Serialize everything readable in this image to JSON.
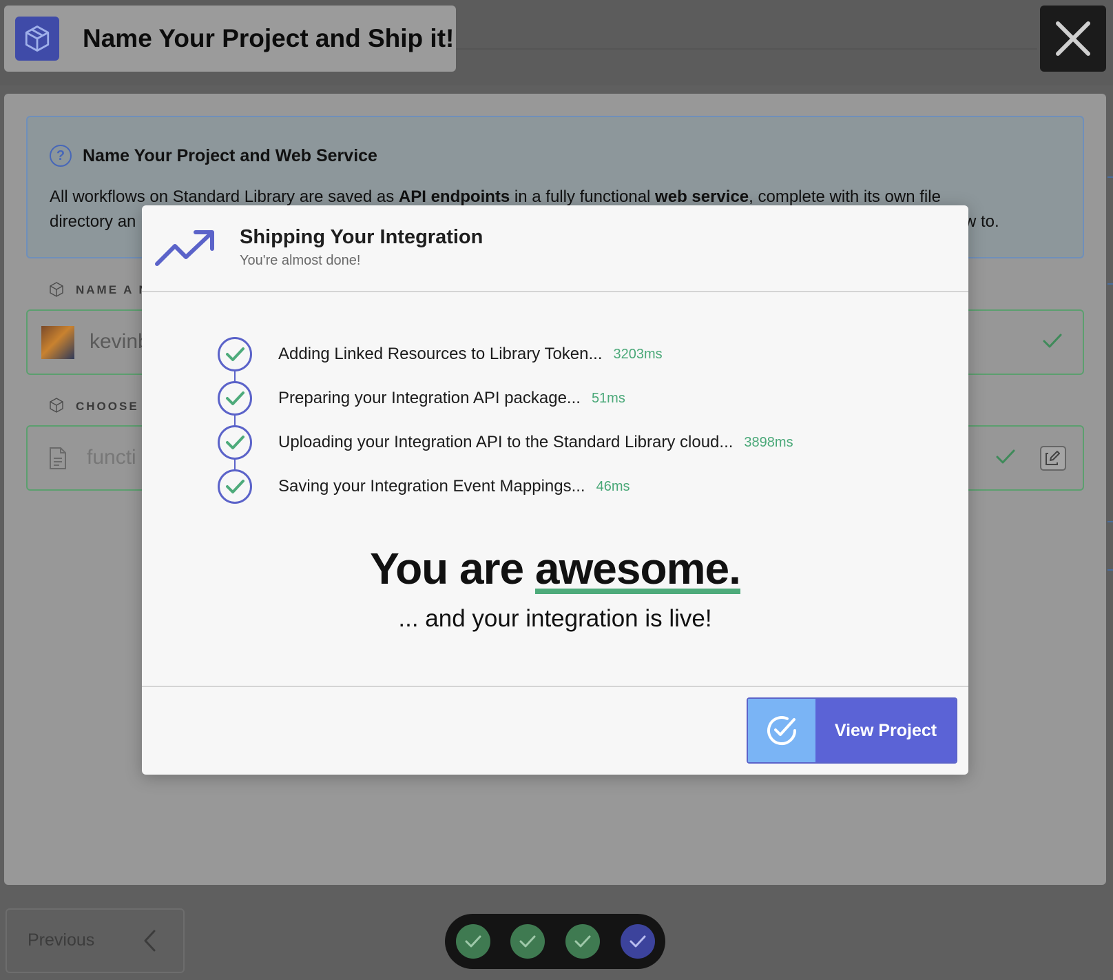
{
  "header": {
    "title": "Name Your Project and Ship it!",
    "icon": "package-icon",
    "close_icon": "close-icon"
  },
  "info": {
    "title": "Name Your Project and Web Service",
    "line1_prefix": "All workflows on Standard Library are saved as ",
    "line1_bold1": "API endpoints",
    "line1_mid": " in a fully functional ",
    "line1_bold2": "web service",
    "line1_suffix": ", complete with its own file",
    "line2_start": "directory an",
    "line2_end": "w to."
  },
  "fields": {
    "name_label": "NAME A N",
    "name_value": "kevinb",
    "choose_label": "CHOOSE T",
    "choose_value": "functi"
  },
  "modal": {
    "title": "Shipping Your Integration",
    "subtitle": "You're almost done!",
    "steps": [
      {
        "label": "Adding Linked Resources to Library Token...",
        "time": "3203ms"
      },
      {
        "label": "Preparing your Integration API package...",
        "time": "51ms"
      },
      {
        "label": "Uploading your Integration API to the Standard Library cloud...",
        "time": "3898ms"
      },
      {
        "label": "Saving your Integration Event Mappings...",
        "time": "46ms"
      }
    ],
    "headline_prefix": "You are ",
    "headline_word": "awesome.",
    "subheadline": "... and your integration is live!",
    "button_label": "View Project"
  },
  "footer": {
    "previous_label": "Previous",
    "steps_completed": 3,
    "steps_total": 4
  },
  "colors": {
    "accent": "#5b63d6",
    "success": "#4eab7b",
    "button_icon_bg": "#7ab4f5"
  }
}
